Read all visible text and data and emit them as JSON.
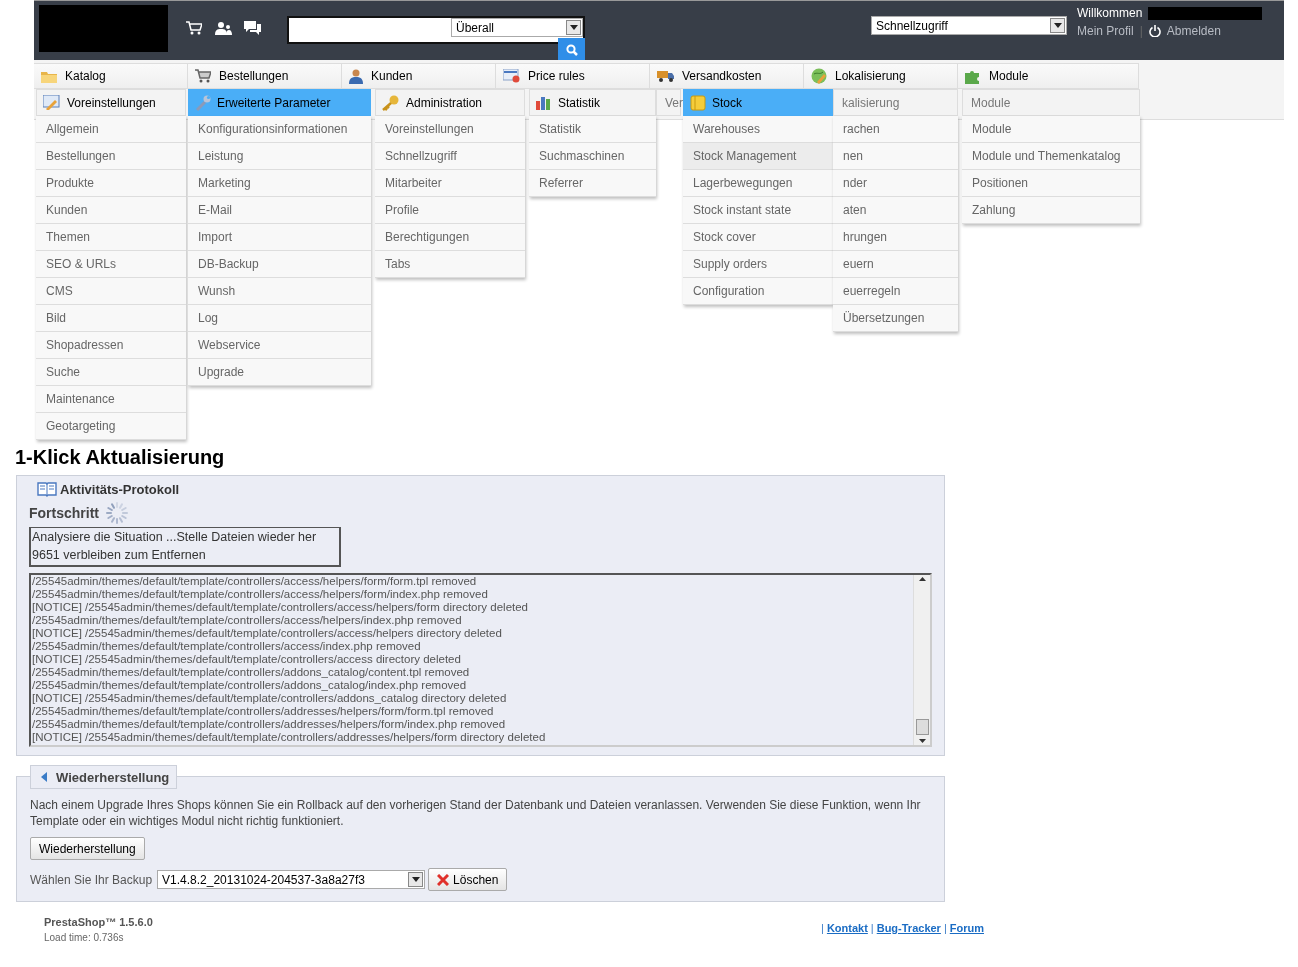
{
  "search": {
    "scope": "Überall"
  },
  "quick_access": "Schnellzugriff",
  "user": {
    "greeting": "Willkommen",
    "profile_link": "Mein Profil",
    "separator": "|",
    "logout_link": "Abmelden"
  },
  "top_menu": [
    {
      "label": "Katalog"
    },
    {
      "label": "Bestellungen"
    },
    {
      "label": "Kunden"
    },
    {
      "label": "Price rules"
    },
    {
      "label": "Versandkosten"
    },
    {
      "label": "Lokalisierung"
    },
    {
      "label": "Module"
    }
  ],
  "flyouts": [
    {
      "header": "Voreinstellungen",
      "selected": false,
      "items": [
        "Allgemein",
        "Bestellungen",
        "Produkte",
        "Kunden",
        "Themen",
        "SEO & URLs",
        "CMS",
        "Bild",
        "Shopadressen",
        "Suche",
        "Maintenance",
        "Geotargeting"
      ]
    },
    {
      "header": "Erweiterte Parameter",
      "selected": true,
      "items": [
        "Konfigurationsinformationen",
        "Leistung",
        "Marketing",
        "E-Mail",
        "Import",
        "DB-Backup",
        "Wunsh",
        "Log",
        "Webservice",
        "Upgrade"
      ]
    },
    {
      "header": "Administration",
      "selected": false,
      "items": [
        "Voreinstellungen",
        "Schnellzugriff",
        "Mitarbeiter",
        "Profile",
        "Berechtigungen",
        "Tabs"
      ]
    },
    {
      "header": "Statistik",
      "selected": false,
      "items": [
        "Statistik",
        "Suchmaschinen",
        "Referrer"
      ]
    },
    {
      "header": "Ver",
      "selected": false
    },
    {
      "header": "Stock",
      "selected": true,
      "items": [
        {
          "label": "Warehouses",
          "highlighted": false
        },
        {
          "label": "Stock Management",
          "highlighted": true
        },
        {
          "label": "Lagerbewegungen",
          "highlighted": false
        },
        {
          "label": "Stock instant state",
          "highlighted": false
        },
        {
          "label": "Stock cover",
          "highlighted": false
        },
        {
          "label": "Supply orders",
          "highlighted": false
        },
        {
          "label": "Configuration",
          "highlighted": false
        }
      ]
    },
    {
      "header": "kalisierung",
      "selected": false,
      "items": [
        "rachen",
        "nen",
        "nder",
        "aten",
        "hrungen",
        "euern",
        "euerregeln",
        "Übersetzungen"
      ]
    },
    {
      "header": "Module",
      "selected": false,
      "items": [
        "Module",
        "Module und Themenkatalog",
        "Positionen",
        "Zahlung"
      ]
    }
  ],
  "page": {
    "title": "1-Klick Aktualisierung",
    "log_section": {
      "legend": "Aktivitäts-Protokoll",
      "progress_label": "Fortschritt",
      "progress_lines": [
        "Analysiere die Situation ...Stelle Dateien wieder her",
        "9651 verbleiben zum Entfernen"
      ],
      "log_lines": [
        "/25545admin/themes/default/template/controllers/access/helpers/form/form.tpl removed",
        "/25545admin/themes/default/template/controllers/access/helpers/form/index.php removed",
        "[NOTICE] /25545admin/themes/default/template/controllers/access/helpers/form directory deleted",
        "/25545admin/themes/default/template/controllers/access/helpers/index.php removed",
        "[NOTICE] /25545admin/themes/default/template/controllers/access/helpers directory deleted",
        "/25545admin/themes/default/template/controllers/access/index.php removed",
        "[NOTICE] /25545admin/themes/default/template/controllers/access directory deleted",
        "/25545admin/themes/default/template/controllers/addons_catalog/content.tpl removed",
        "/25545admin/themes/default/template/controllers/addons_catalog/index.php removed",
        "[NOTICE] /25545admin/themes/default/template/controllers/addons_catalog directory deleted",
        "/25545admin/themes/default/template/controllers/addresses/helpers/form/form.tpl removed",
        "/25545admin/themes/default/template/controllers/addresses/helpers/form/index.php removed",
        "[NOTICE] /25545admin/themes/default/template/controllers/addresses/helpers/form directory deleted"
      ]
    },
    "restore_section": {
      "legend": "Wiederherstellung",
      "description": "Nach einem Upgrade Ihres Shops können Sie ein Rollback auf den vorherigen Stand der Datenbank und Dateien veranlassen. Verwenden Sie diese Funktion, wenn Ihr Template oder ein wichtiges Modul nicht richtig funktioniert.",
      "restore_button": "Wiederherstellung",
      "backup_label": "Wählen Sie Ihr Backup",
      "backup_value": "V1.4.8.2_20131024-204537-3a8a27f3",
      "delete_button": "Löschen"
    }
  },
  "footer": {
    "version": "PrestaShop™ 1.5.6.0",
    "load_time": "Load time: 0.736s",
    "separator": "|",
    "links": [
      "Kontakt",
      "Bug-Tracker",
      "Forum"
    ]
  }
}
